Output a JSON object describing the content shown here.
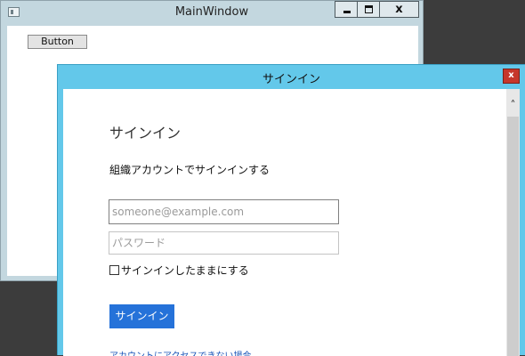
{
  "main_window": {
    "title": "MainWindow",
    "button_label": "Button",
    "caption": {
      "minimize": "minimize-icon",
      "maximize": "maximize-icon",
      "close": "x"
    }
  },
  "signin_dialog": {
    "title": "サインイン",
    "close_glyph": "x",
    "heading": "サインイン",
    "subheading": "組織アカウントでサインインする",
    "email_placeholder": "someone@example.com",
    "password_placeholder": "パスワード",
    "keep_signed_in_label": "サインインしたままにする",
    "signin_button_label": "サインイン",
    "help_link": "アカウントにアクセスできない場合",
    "scroll_up_glyph": "˄"
  },
  "colors": {
    "dialog_frame": "#63c8ea",
    "dialog_close": "#c6372b",
    "signin_button": "#2572d9",
    "link": "#1a55b8",
    "main_frame": "#c3d7df"
  }
}
